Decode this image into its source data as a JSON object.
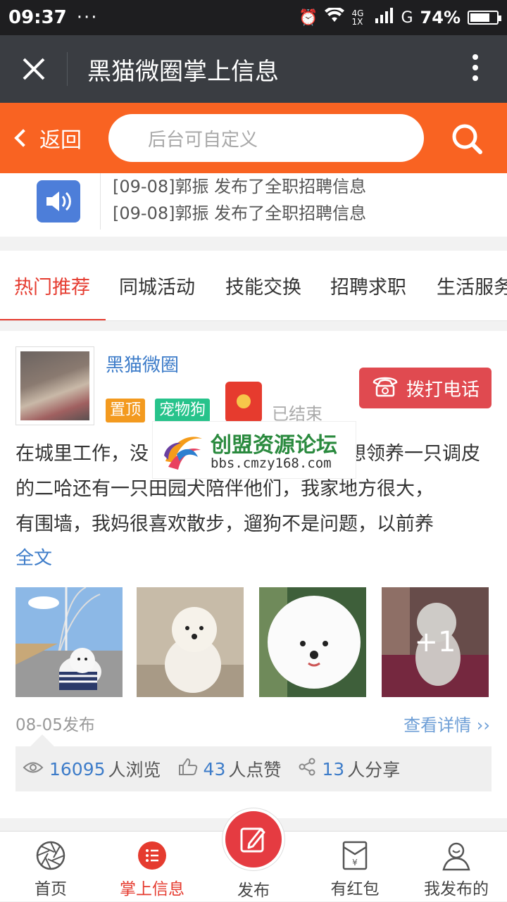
{
  "status_bar": {
    "time": "09:37",
    "dots": "···",
    "network": "4G 1X",
    "carrier": "G",
    "battery": "74%",
    "battery_level": 0.74
  },
  "wechat_bar": {
    "title": "黑猫微圈掌上信息"
  },
  "top_bar": {
    "back_label": "返回",
    "search_placeholder": "后台可自定义"
  },
  "notice": {
    "lines": [
      "[09-08]郭振 发布了全职招聘信息",
      "[09-08]郭振 发布了全职招聘信息"
    ]
  },
  "tabs": [
    {
      "label": "热门推荐",
      "active": true
    },
    {
      "label": "同城活动",
      "active": false
    },
    {
      "label": "技能交换",
      "active": false
    },
    {
      "label": "招聘求职",
      "active": false
    },
    {
      "label": "生活服务",
      "active": false
    }
  ],
  "post": {
    "author": "黑猫微圈",
    "badges": [
      "置顶",
      "宠物狗"
    ],
    "redpacket_status": "已结束",
    "call_label": "拨打电话",
    "content": "在城里工作，没…………想领养一只调皮的二哈还有一只田园犬陪伴他们，我家地方很大，有围墙，我妈很喜欢散步，遛狗不是问题，以前养",
    "content_visible_lines": [
      "在城里工作，没",
      "想领养一只调皮",
      "的二哈还有一只田园犬陪伴他们，我家地方很大，",
      "有围墙，我妈很喜欢散步，遛狗不是问题，以前养"
    ],
    "fulltext_label": "全文",
    "extra_images": "+1",
    "date": "08-05发布",
    "detail_label": "查看详情 ››",
    "views": "16095",
    "views_label": "人浏览",
    "likes": "43",
    "likes_label": "人点赞",
    "shares": "13",
    "shares_label": "人分享"
  },
  "watermark": {
    "title": "创盟资源论坛",
    "url": "bbs.cmzy168.com"
  },
  "bottom_nav": [
    {
      "label": "首页",
      "icon": "aperture-icon",
      "active": false
    },
    {
      "label": "掌上信息",
      "icon": "list-icon",
      "active": true
    },
    {
      "label": "发布",
      "icon": "edit-icon",
      "active": false
    },
    {
      "label": "有红包",
      "icon": "red-envelope-icon",
      "active": false
    },
    {
      "label": "我发布的",
      "icon": "user-icon",
      "active": false
    }
  ],
  "colors": {
    "accent_orange": "#f96322",
    "active_red": "#e53b2f",
    "link_blue": "#3d7cc9"
  }
}
